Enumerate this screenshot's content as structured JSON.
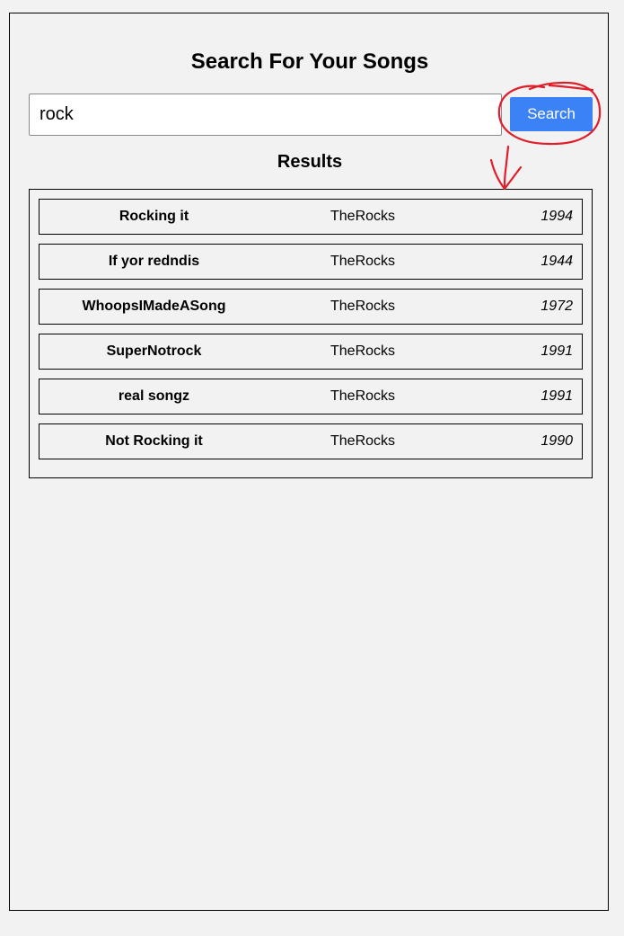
{
  "header": {
    "title": "Search For Your Songs"
  },
  "search": {
    "value": "rock",
    "button_label": "Search"
  },
  "results": {
    "heading": "Results",
    "rows": [
      {
        "title": "Rocking it",
        "artist": "TheRocks",
        "year": "1994"
      },
      {
        "title": "If yor redndis",
        "artist": "TheRocks",
        "year": "1944"
      },
      {
        "title": "WhoopsIMadeASong",
        "artist": "TheRocks",
        "year": "1972"
      },
      {
        "title": "SuperNotrock",
        "artist": "TheRocks",
        "year": "1991"
      },
      {
        "title": "real songz",
        "artist": "TheRocks",
        "year": "1991"
      },
      {
        "title": "Not Rocking it",
        "artist": "TheRocks",
        "year": "1990"
      }
    ]
  },
  "colors": {
    "background": "#f2f2f2",
    "button": "#3b82f6",
    "annotation": "#e11d2a"
  }
}
